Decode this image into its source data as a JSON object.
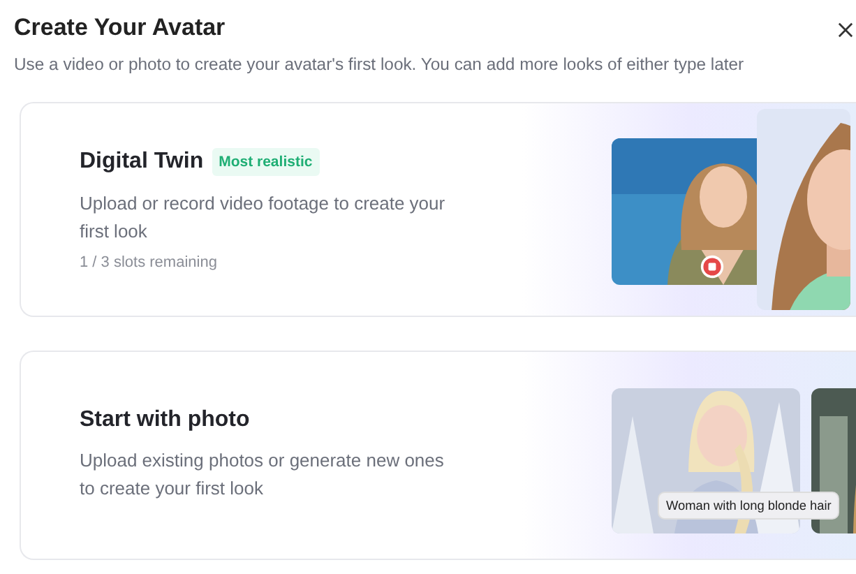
{
  "dialog": {
    "title": "Create Your Avatar",
    "subtitle": "Use a video or photo to create your avatar's first look. You can add more looks of either type later"
  },
  "options": [
    {
      "kind": "video",
      "title": "Digital Twin",
      "badge": "Most realistic",
      "description": "Upload or record video footage to create your first look",
      "note": "1 / 3 slots remaining"
    },
    {
      "title": "Start with photo",
      "description": "Upload existing photos or generate new ones to create your first look",
      "caption": "Woman with long blonde hair"
    }
  ]
}
